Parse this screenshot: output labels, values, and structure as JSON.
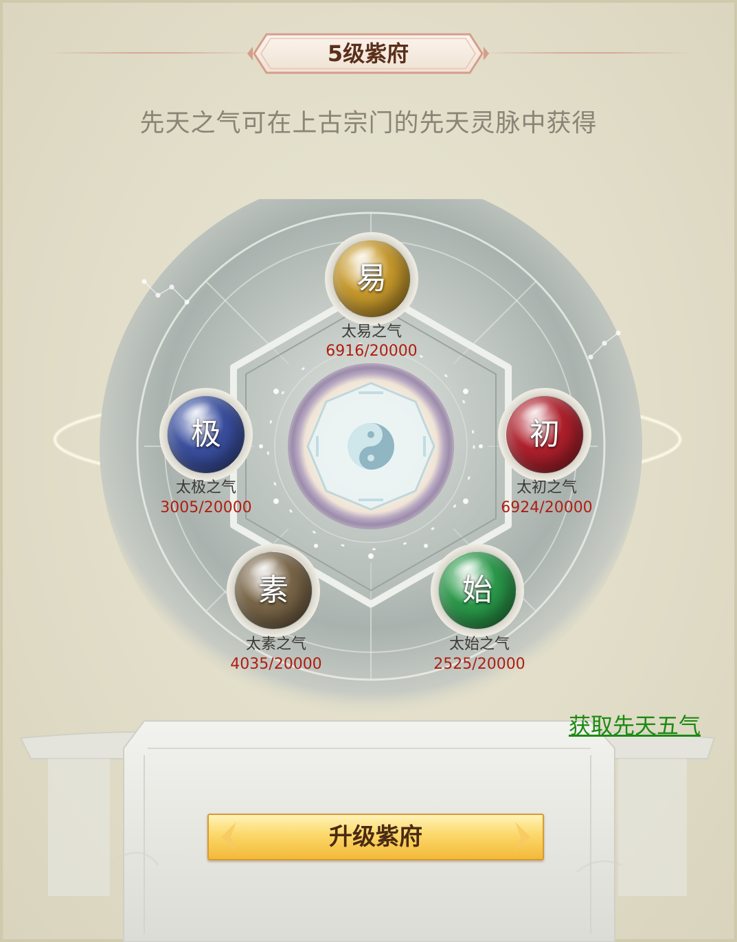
{
  "title": "5级紫府",
  "hint": "先天之气可在上古宗门的先天灵脉中获得",
  "center_icon": "yin-yang-bagua-icon",
  "orbs": [
    {
      "key": "yi",
      "glyph": "易",
      "name": "太易之气",
      "count": "6916/20000",
      "current": 6916,
      "max": 20000,
      "color": "#c89a2c"
    },
    {
      "key": "chu",
      "glyph": "初",
      "name": "太初之气",
      "count": "6924/20000",
      "current": 6924,
      "max": 20000,
      "color": "#b0202c"
    },
    {
      "key": "shi",
      "glyph": "始",
      "name": "太始之气",
      "count": "2525/20000",
      "current": 2525,
      "max": 20000,
      "color": "#2a9a4a"
    },
    {
      "key": "su",
      "glyph": "素",
      "name": "太素之气",
      "count": "4035/20000",
      "current": 4035,
      "max": 20000,
      "color": "#7a6648"
    },
    {
      "key": "ji",
      "glyph": "极",
      "name": "太极之气",
      "count": "3005/20000",
      "current": 3005,
      "max": 20000,
      "color": "#3a4fa0"
    }
  ],
  "get_link": "获取先天五气",
  "upgrade_button": "升级紫府",
  "colors": {
    "background": "#ddd9c4",
    "count_red": "#b01d10",
    "link_green": "#1c8a12",
    "button_gold": "#fbd86a",
    "title_brown": "#5a2f1a"
  }
}
